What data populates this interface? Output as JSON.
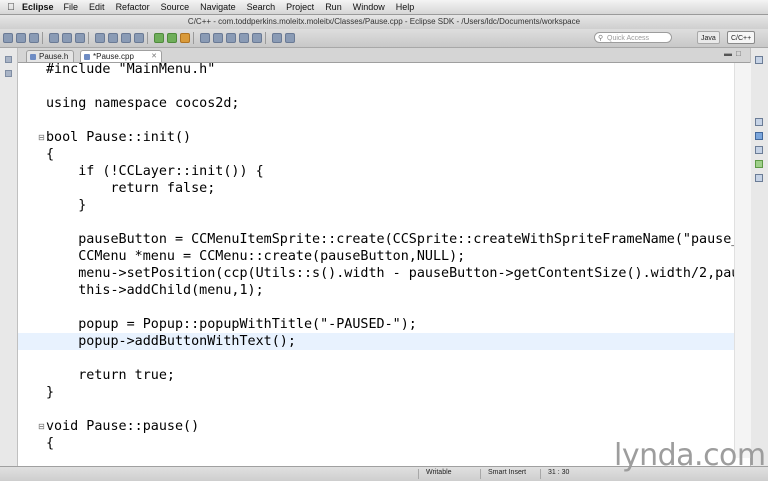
{
  "menubar": {
    "app_name": "Eclipse",
    "items": [
      "File",
      "Edit",
      "Refactor",
      "Source",
      "Navigate",
      "Search",
      "Project",
      "Run",
      "Window",
      "Help"
    ]
  },
  "window": {
    "title": "C/C++ - com.toddperkins.moleitx.moleitx/Classes/Pause.cpp - Eclipse SDK - /Users/ldc/Documents/workspace"
  },
  "toolbar": {
    "quick_access_placeholder": "Quick Access",
    "perspectives": [
      "Java",
      "C/C++"
    ]
  },
  "tabs": [
    {
      "label": "Pause.h",
      "active": false
    },
    {
      "label": "*Pause.cpp",
      "active": true
    }
  ],
  "editor": {
    "lines": [
      "#include \"MainMenu.h\"",
      "",
      "using namespace cocos2d;",
      "",
      "bool Pause::init()",
      "{",
      "    if (!CCLayer::init()) {",
      "        return false;",
      "    }",
      "",
      "    pauseButton = CCMenuItemSprite::create(CCSprite::createWithSpriteFrameName(\"pause_butto",
      "    CCMenu *menu = CCMenu::create(pauseButton,NULL);",
      "    menu->setPosition(ccp(Utils::s().width - pauseButton->getContentSize().width/2,pauseBut",
      "    this->addChild(menu,1);",
      "",
      "    popup = Popup::popupWithTitle(\"-PAUSED-\");",
      "    popup->addButtonWithText();",
      "",
      "    return true;",
      "}",
      "",
      "void Pause::pause()",
      "{"
    ]
  },
  "status": {
    "mode": "Writable",
    "insert_mode": "Smart Insert",
    "position": "31 : 30"
  },
  "watermark": "lynda.com"
}
